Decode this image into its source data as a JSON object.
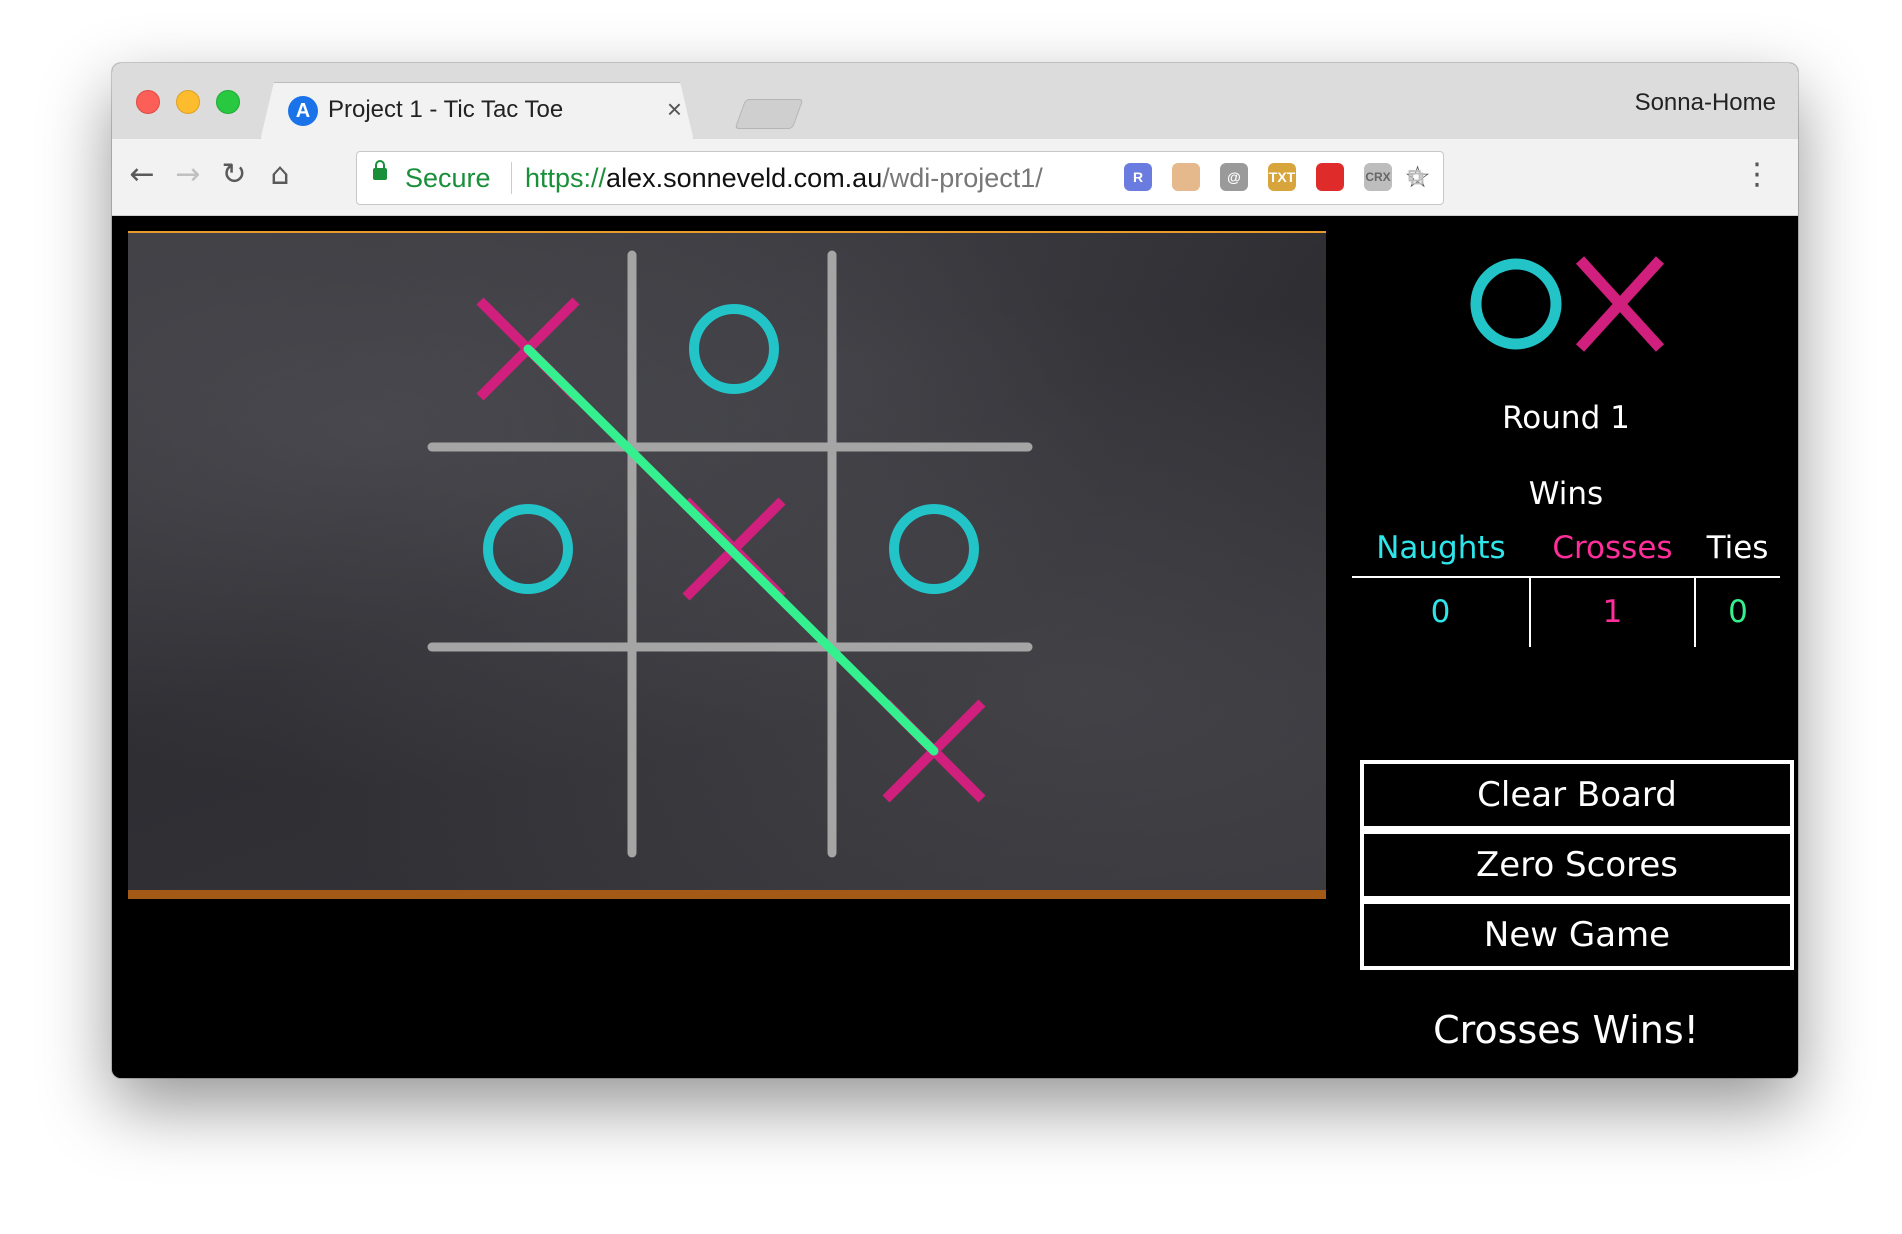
{
  "browser": {
    "tab_title": "Project 1 - Tic Tac Toe",
    "tab_favicon_letter": "A",
    "tab_close": "×",
    "profile_name": "Sonna-Home",
    "security_label": "Secure",
    "url_scheme": "https://",
    "url_host": "alex.sonneveld.com.au",
    "url_path": "/wdi-project1/",
    "extensions": [
      {
        "name": "R",
        "color": "#6b7ce0"
      },
      {
        "name": "",
        "color": "#e6b98c"
      },
      {
        "name": "@",
        "color": "#9a9a9a"
      },
      {
        "name": "TXT",
        "color": "#d8a43c"
      },
      {
        "name": "",
        "color": "#e02b2b"
      },
      {
        "name": "CRX",
        "color": "#bdbdbd"
      }
    ]
  },
  "game": {
    "board": [
      "X",
      "O",
      "",
      "O",
      "X",
      "O",
      "",
      "",
      "X"
    ],
    "winning_line": [
      0,
      8
    ],
    "colors": {
      "naught": "#22c4c8",
      "cross": "#d01f7d",
      "win_line": "#35f08e",
      "grid": "#a5a5a5"
    }
  },
  "sidebar": {
    "round_label": "Round 1",
    "wins_title": "Wins",
    "columns": [
      {
        "label": "Naughts",
        "color": "#2ee6ea",
        "value": "0",
        "value_color": "#2ee6ea"
      },
      {
        "label": "Crosses",
        "color": "#ff2e9a",
        "value": "1",
        "value_color": "#ff2e9a"
      },
      {
        "label": "Ties",
        "color": "#ffffff",
        "value": "0",
        "value_color": "#35f08e"
      }
    ],
    "buttons": {
      "clear_board": "Clear Board",
      "zero_scores": "Zero Scores",
      "new_game": "New Game"
    },
    "status_message": "Crosses Wins!"
  }
}
